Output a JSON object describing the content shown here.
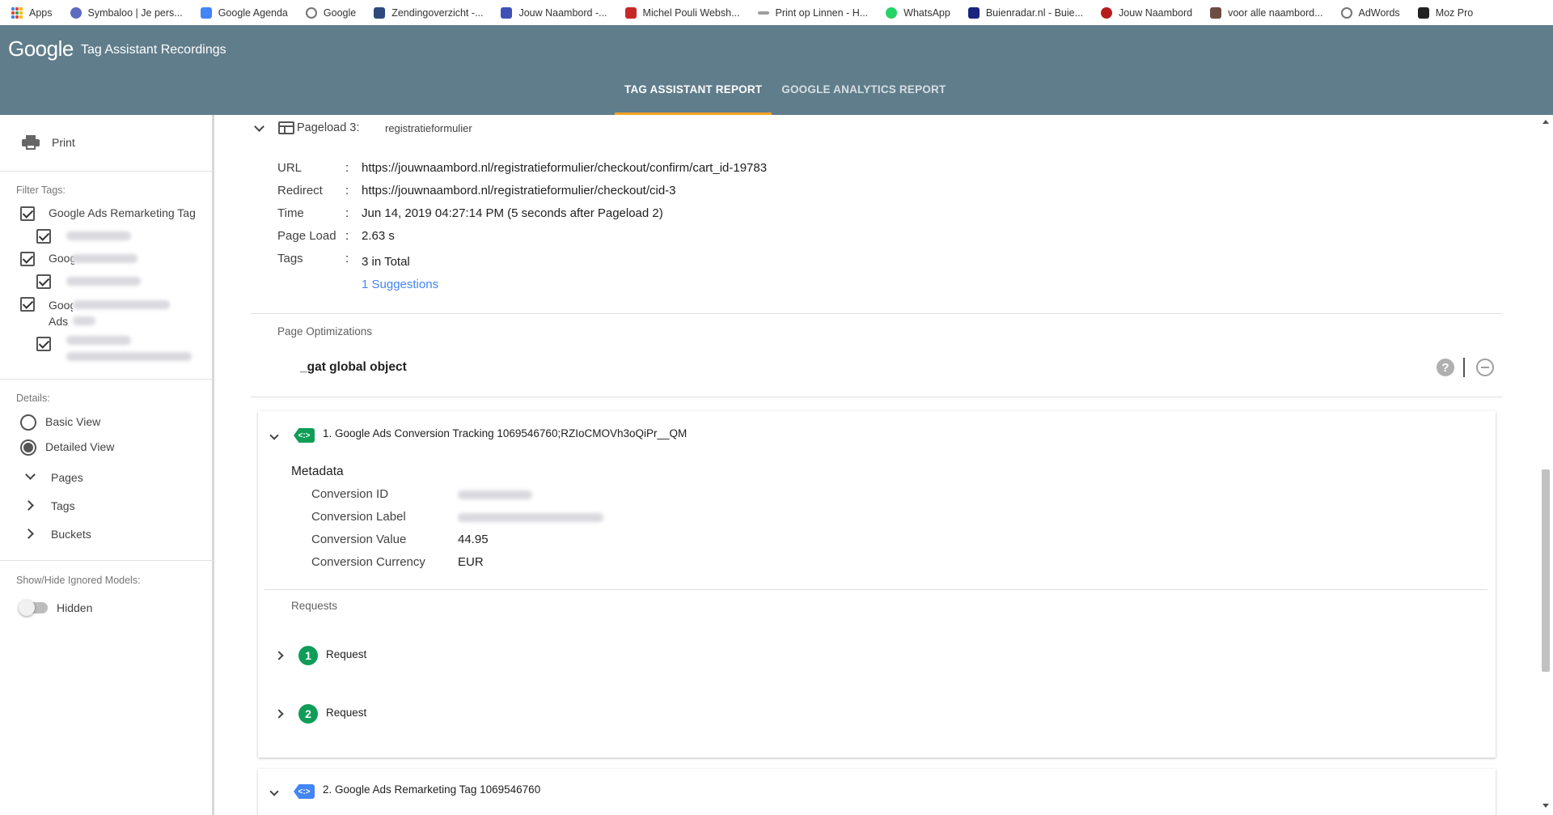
{
  "bookmarks": [
    {
      "label": "Apps",
      "icon": "apps-grid-icon",
      "color": "#4285f4"
    },
    {
      "label": "Symbaloo | Je pers...",
      "icon": "symbaloo-icon",
      "color": "#5c6bc0"
    },
    {
      "label": "Google Agenda",
      "icon": "calendar-icon",
      "color": "#4285f4"
    },
    {
      "label": "Google",
      "icon": "google-g-icon",
      "color": "#757575"
    },
    {
      "label": "Zendingoverzicht -...",
      "icon": "shipping-icon",
      "color": "#2e4a7d"
    },
    {
      "label": "Jouw Naambord -...",
      "icon": "naambord-icon",
      "color": "#3f51b5"
    },
    {
      "label": "Michel Pouli Websh...",
      "icon": "shop-icon",
      "color": "#c62828"
    },
    {
      "label": "Print op Linnen - H...",
      "icon": "linnen-icon",
      "color": "#9e9e9e"
    },
    {
      "label": "WhatsApp",
      "icon": "whatsapp-icon",
      "color": "#25d366"
    },
    {
      "label": "Buienradar.nl - Buie...",
      "icon": "buienradar-icon",
      "color": "#1a237e"
    },
    {
      "label": "Jouw Naambord",
      "icon": "naambord-round-icon",
      "color": "#b71c1c"
    },
    {
      "label": "voor alle naambord...",
      "icon": "puzzle-icon",
      "color": "#6d4c41"
    },
    {
      "label": "AdWords",
      "icon": "google-g-icon",
      "color": "#757575"
    },
    {
      "label": "Moz Pro",
      "icon": "moz-icon",
      "color": "#212121"
    }
  ],
  "header": {
    "logo": "Google",
    "title": "Tag Assistant Recordings",
    "tabs": [
      {
        "label": "TAG ASSISTANT REPORT",
        "active": true
      },
      {
        "label": "GOOGLE ANALYTICS REPORT",
        "active": false
      }
    ],
    "accent": "#f4a423",
    "background": "#607d8b"
  },
  "sidebar": {
    "print_label": "Print",
    "filter_label": "Filter Tags:",
    "filter_tags": [
      {
        "label": "Google Ads Remarketing Tag",
        "checked": true
      },
      {
        "label": "Google Analytics",
        "checked": true
      },
      {
        "label": "Google Ads Conversion Tracking",
        "checked": true
      }
    ],
    "details_label": "Details:",
    "views": [
      {
        "label": "Basic View",
        "selected": false
      },
      {
        "label": "Detailed View",
        "selected": true
      }
    ],
    "sections": [
      {
        "label": "Pages",
        "expanded": true
      },
      {
        "label": "Tags",
        "expanded": false
      },
      {
        "label": "Buckets",
        "expanded": false
      }
    ],
    "ignored_label": "Show/Hide Ignored Models:",
    "ignored_state": "Hidden"
  },
  "pageload": {
    "title": "Pageload 3:",
    "name": "registratieformulier",
    "fields": [
      {
        "key": "URL",
        "value": "https://jouwnaambord.nl/registratieformulier/checkout/confirm/cart_id-19783"
      },
      {
        "key": "Redirect",
        "value": "https://jouwnaambord.nl/registratieformulier/checkout/cid-3"
      },
      {
        "key": "Time",
        "value": "Jun 14, 2019 04:27:14 PM (5 seconds after Pageload 2)"
      },
      {
        "key": "Page Load",
        "value": "2.63 s"
      },
      {
        "key": "Tags",
        "value": "3 in Total"
      }
    ],
    "colon": ":",
    "suggestions_link": "1 Suggestions",
    "optimizations_label": "Page Optimizations",
    "optimization_item": "_gat global object",
    "help_glyph": "?"
  },
  "tags": [
    {
      "title": "1. Google Ads Conversion Tracking 1069546760;RZIoCMOVh3oQiPr__QM",
      "icon_glyph": "<:>",
      "icon_color": "#0f9d58",
      "metadata_label": "Metadata",
      "metadata": [
        {
          "key": "Conversion ID",
          "value": null
        },
        {
          "key": "Conversion Label",
          "value": null
        },
        {
          "key": "Conversion Value",
          "value": "44.95"
        },
        {
          "key": "Conversion Currency",
          "value": "EUR"
        }
      ],
      "requests_label": "Requests",
      "requests": [
        {
          "num": "1",
          "label": "Request"
        },
        {
          "num": "2",
          "label": "Request"
        }
      ]
    },
    {
      "title": "2. Google Ads Remarketing Tag 1069546760",
      "icon_glyph": "<:>",
      "icon_color": "#4285f4"
    }
  ]
}
